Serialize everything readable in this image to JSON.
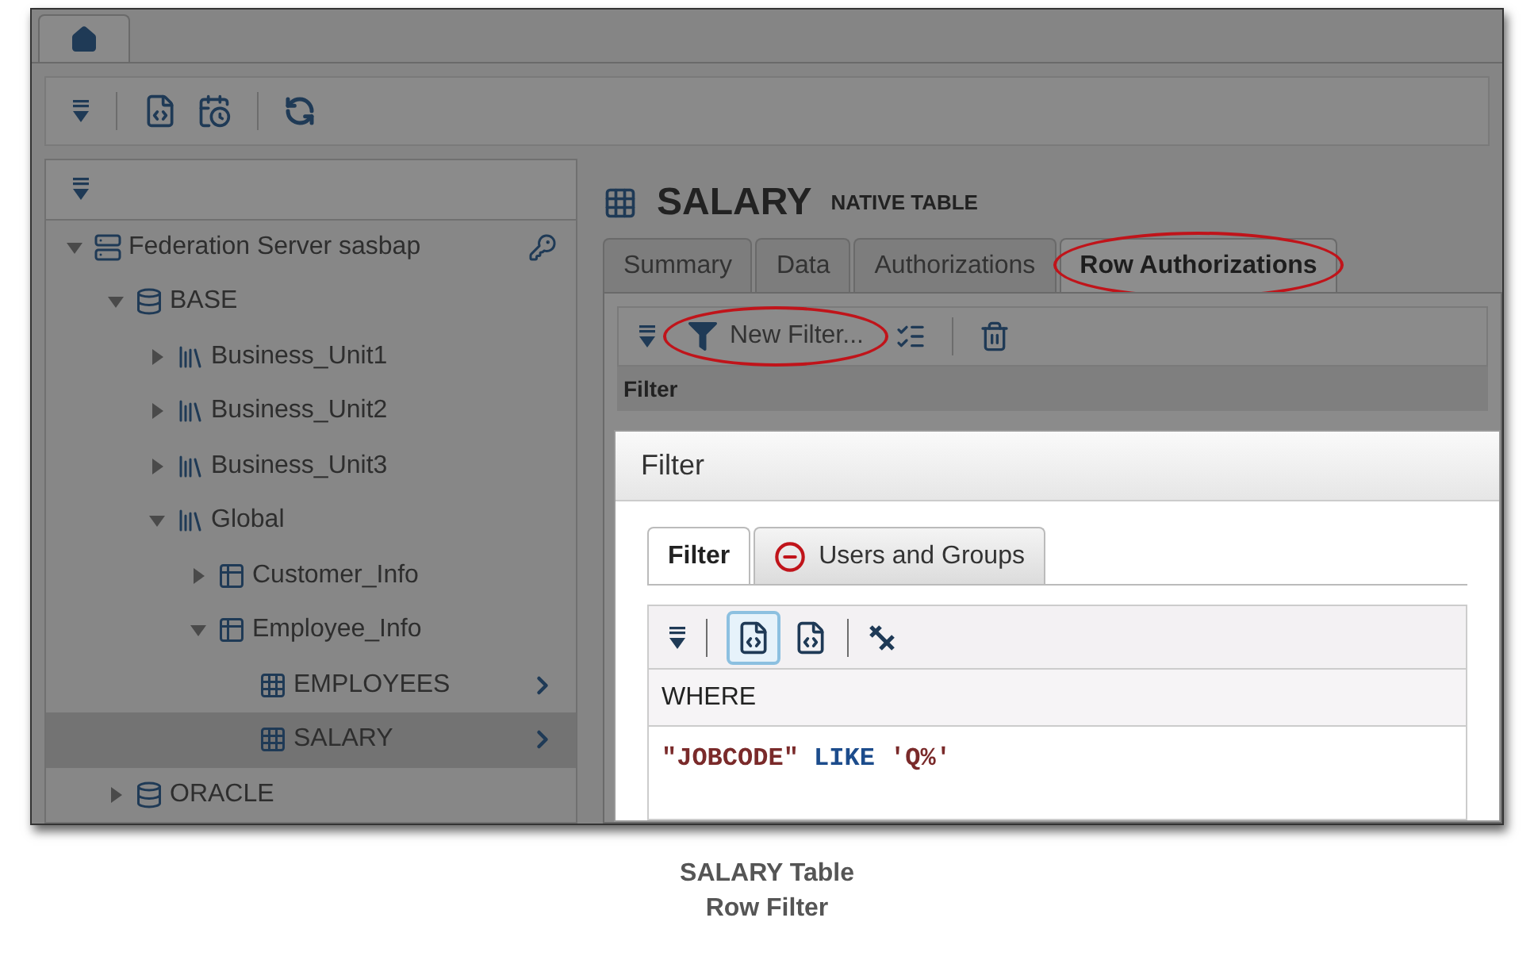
{
  "tree": [
    {
      "label": "Federation Server sasbap",
      "kind": "server",
      "expanded": true,
      "selected": false,
      "key": true,
      "children": [
        {
          "label": "BASE",
          "kind": "database",
          "expanded": true,
          "selected": false,
          "children": [
            {
              "label": "Business_Unit1",
              "kind": "catalog",
              "expanded": false,
              "selected": false
            },
            {
              "label": "Business_Unit2",
              "kind": "catalog",
              "expanded": false,
              "selected": false
            },
            {
              "label": "Business_Unit3",
              "kind": "catalog",
              "expanded": false,
              "selected": false
            },
            {
              "label": "Global",
              "kind": "catalog",
              "expanded": true,
              "selected": false,
              "children": [
                {
                  "label": "Customer_Info",
                  "kind": "schema",
                  "expanded": false,
                  "selected": false
                },
                {
                  "label": "Employee_Info",
                  "kind": "schema",
                  "expanded": true,
                  "selected": false,
                  "children": [
                    {
                      "label": "EMPLOYEES",
                      "kind": "table",
                      "selected": false
                    },
                    {
                      "label": "SALARY",
                      "kind": "table",
                      "selected": true
                    }
                  ]
                }
              ]
            }
          ]
        },
        {
          "label": "ORACLE",
          "kind": "database",
          "expanded": false,
          "selected": false
        }
      ]
    }
  ],
  "detail": {
    "title": "SALARY",
    "subtitle": "NATIVE TABLE",
    "tabs": [
      {
        "label": "Summary",
        "selected": false,
        "circled": false
      },
      {
        "label": "Data",
        "selected": false,
        "circled": false
      },
      {
        "label": "Authorizations",
        "selected": false,
        "circled": false
      },
      {
        "label": "Row Authorizations",
        "selected": true,
        "circled": true
      }
    ],
    "new_filter_button": {
      "label": "New Filter...",
      "circled": true
    },
    "column": "Filter"
  },
  "dialog": {
    "title": "Filter",
    "tabs": [
      {
        "label": "Filter",
        "selected": true,
        "error": false
      },
      {
        "label": "Users and Groups",
        "selected": false,
        "error": true
      }
    ],
    "sql_toggle": {
      "selected": true
    },
    "clause": "WHERE",
    "code": [
      {
        "text": "\"JOBCODE\"",
        "kind": "string"
      },
      {
        "text": "LIKE",
        "kind": "keyword"
      },
      {
        "text": "'Q%'",
        "kind": "string"
      }
    ]
  },
  "caption": [
    "SALARY Table",
    "Row Filter"
  ]
}
